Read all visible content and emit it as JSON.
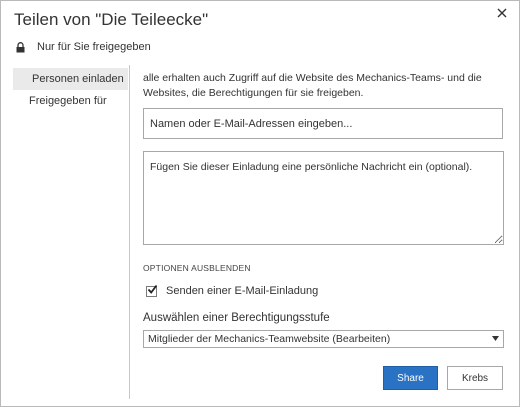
{
  "dialog": {
    "title": "Teilen von \"Die Teileecke\"",
    "close_icon": "close-icon",
    "shared_status": "Nur für Sie freigegeben",
    "shared_icon": "lock-icon"
  },
  "sidebar": {
    "items": [
      {
        "label": "Personen einladen",
        "active": true
      },
      {
        "label": "Freigegeben für",
        "active": false
      }
    ]
  },
  "main": {
    "description": "alle erhalten auch Zugriff auf die Website des Mechanics-Teams- und die Websites, die Berechtigungen für sie freigeben.",
    "people_placeholder": "Namen oder E-Mail-Adressen eingeben...",
    "message_placeholder": "Fügen Sie dieser Einladung eine persönliche Nachricht ein (optional).",
    "options_toggle": "OPTIONEN AUSBLENDEN",
    "send_invite_label": "Senden einer E-Mail-Einladung",
    "send_invite_checked": true,
    "permission_label": "Auswählen einer Berechtigungsstufe",
    "permission_selected": "Mitglieder der Mechanics-Teamwebsite (Bearbeiten)",
    "share_button": "Share",
    "cancel_button": "Krebs"
  },
  "colors": {
    "primary_button": "#2a72c4",
    "active_tab_bg": "#eaeaea"
  }
}
